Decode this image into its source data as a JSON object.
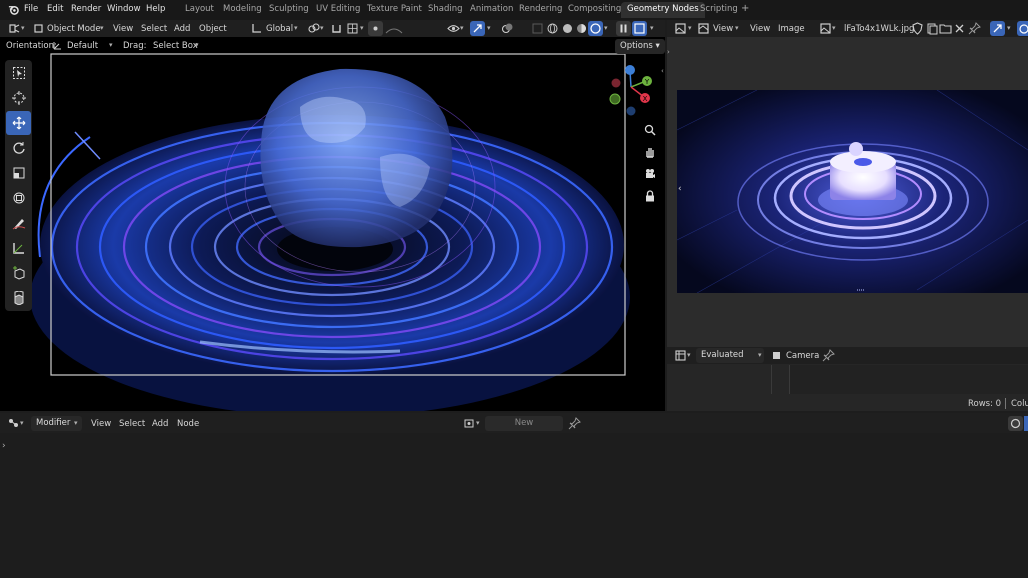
{
  "menu": [
    "File",
    "Edit",
    "Render",
    "Window",
    "Help"
  ],
  "workspaces": [
    "Layout",
    "Modeling",
    "Sculpting",
    "UV Editing",
    "Texture Paint",
    "Shading",
    "Animation",
    "Rendering",
    "Compositing",
    "Geometry Nodes",
    "Scripting"
  ],
  "add_workspace": "+",
  "viewport": {
    "mode": "Object Mode",
    "menus": [
      "View",
      "Select",
      "Add",
      "Object"
    ],
    "transform_orientation": "Global",
    "orientation_label": "Orientation:",
    "orientation_value": "Default",
    "drag_label": "Drag:",
    "drag_value": "Select Box",
    "options": "Options",
    "gizmo_axes": [
      "Y",
      "X"
    ],
    "tools": [
      "select-box-icon",
      "cursor-icon",
      "move-icon",
      "rotate-icon",
      "scale-icon",
      "transform-icon",
      "annotate-icon",
      "measure-icon",
      "add-cube-icon",
      "extrude-icon"
    ]
  },
  "image_editor": {
    "menus": [
      "View",
      "View",
      "Image"
    ],
    "image_name": "lFaTo4x1WLk.jpg"
  },
  "spreadsheet": {
    "evaluated": "Evaluated",
    "camera": "Camera",
    "rows": "Rows: 0",
    "columns_cut": "Colu"
  },
  "node_editor": {
    "context": "Modifier",
    "menus": [
      "View",
      "Select",
      "Add",
      "Node"
    ],
    "new_label": "New"
  },
  "colors": {
    "accent_blue": "#3a66b8",
    "active_tab": "#303030",
    "axis_x": "#e0364a",
    "axis_y": "#6db33f",
    "axis_z": "#3c7fd8"
  }
}
